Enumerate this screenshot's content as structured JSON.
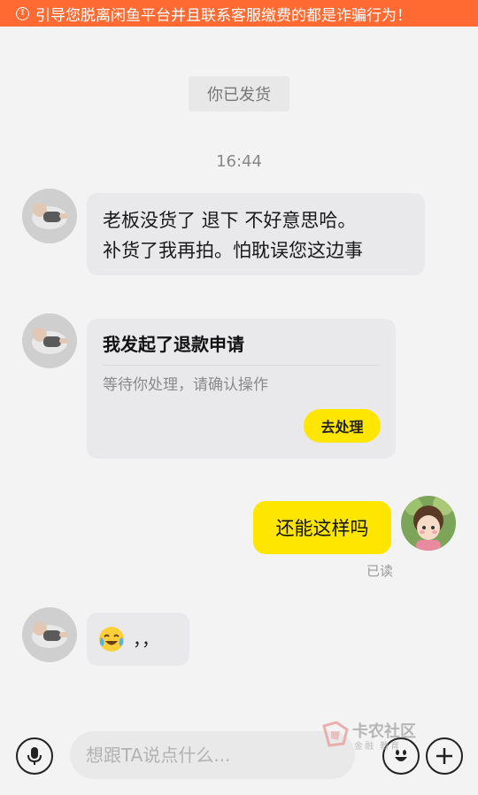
{
  "warning": {
    "icon": "alert-circle-icon",
    "text": "引导您脱离闲鱼平台并且联系客服缴费的都是诈骗行为！"
  },
  "system_message": "你已发货",
  "timestamp": "16:44",
  "messages": {
    "seller_text": {
      "line1": "老板没货了 退下  不好意思哈。",
      "line2": "补货了我再拍。怕耽误您这边事"
    },
    "refund_card": {
      "title": "我发起了退款申请",
      "desc": "等待你处理，请确认操作",
      "button": "去处理"
    },
    "my_message": {
      "text": "还能这样吗",
      "status": "已读"
    },
    "seller_emoji": {
      "emoji": "crying-laughing-emoji-icon",
      "text": "，，"
    }
  },
  "input": {
    "placeholder": "想跟TA说点什么..."
  },
  "watermark": {
    "title": "卡农社区",
    "subtitle": "金融 教育"
  },
  "colors": {
    "warning_bg": "#ff6a33",
    "accent_yellow": "#ffe600",
    "bubble_gray": "#e9e9eb"
  }
}
